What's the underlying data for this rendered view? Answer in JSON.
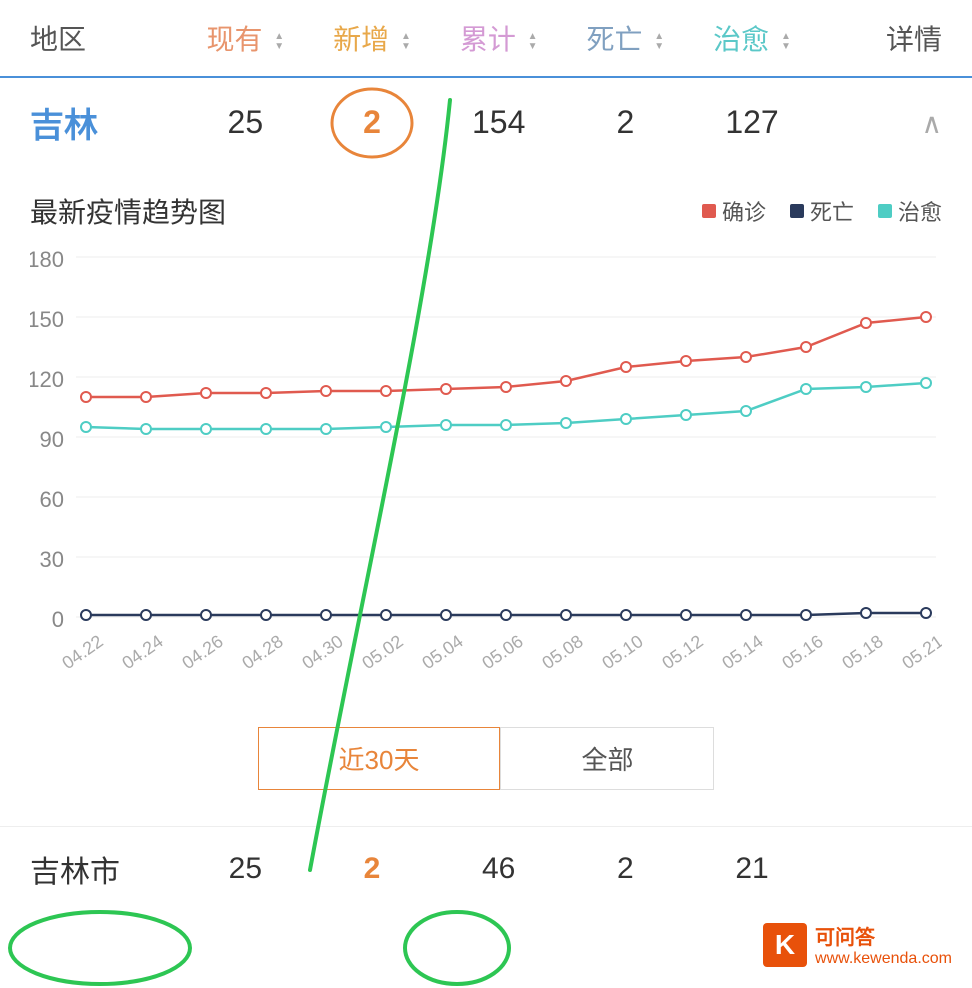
{
  "header": {
    "region_label": "地区",
    "xianyou_label": "现有",
    "xinzeng_label": "新增",
    "leiji_label": "累计",
    "siwang_label": "死亡",
    "zhiyu_label": "治愈",
    "detail_label": "详情"
  },
  "jilin_row": {
    "name": "吉林",
    "xianyou": "25",
    "xinzeng": "2",
    "leiji": "154",
    "siwang": "2",
    "zhiyu": "127"
  },
  "chart": {
    "title": "最新疫情趋势图",
    "legend": [
      {
        "label": "确诊",
        "color": "#e05a4f"
      },
      {
        "label": "死亡",
        "color": "#2a3a5c"
      },
      {
        "label": "治愈",
        "color": "#4ecdc4"
      }
    ],
    "y_labels": [
      "180",
      "150",
      "120",
      "90",
      "60",
      "30",
      "0"
    ],
    "x_labels": [
      "04.22",
      "04.24",
      "04.26",
      "04.28",
      "04.30",
      "05.02",
      "05.04",
      "05.06",
      "05.08",
      "05.10",
      "05.12",
      "05.14",
      "05.16",
      "05.18",
      "05.21"
    ],
    "time_buttons": [
      {
        "label": "近30天",
        "active": true
      },
      {
        "label": "全部",
        "active": false
      }
    ]
  },
  "jilin_city_row": {
    "name": "吉林市",
    "xianyou": "25",
    "xinzeng": "2",
    "leiji": "46",
    "siwang": "2",
    "zhiyu": "21"
  },
  "watermark": {
    "k": "K",
    "site": "可问答",
    "url": "www.kewenda.com"
  }
}
